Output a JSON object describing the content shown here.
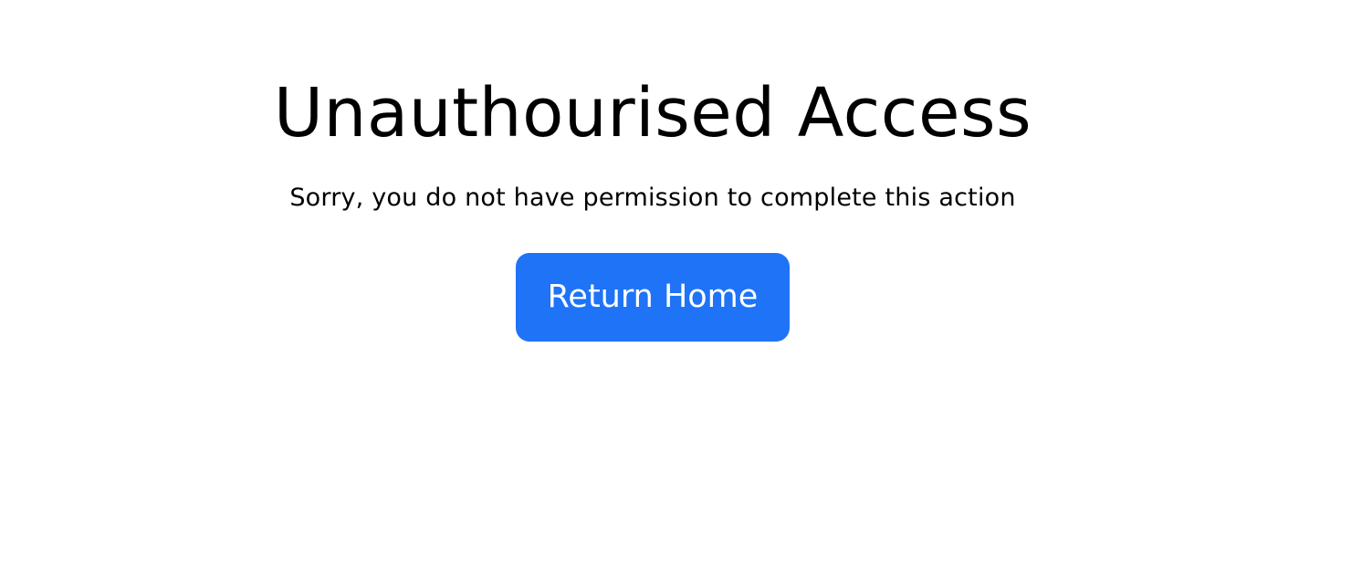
{
  "page": {
    "title": "Unauthourised Access",
    "message": "Sorry, you do not have permission to complete this action"
  },
  "actions": {
    "return_home_label": "Return Home"
  },
  "colors": {
    "primary_button": "#1e73f7",
    "background": "#ffffff",
    "text": "#000000"
  }
}
